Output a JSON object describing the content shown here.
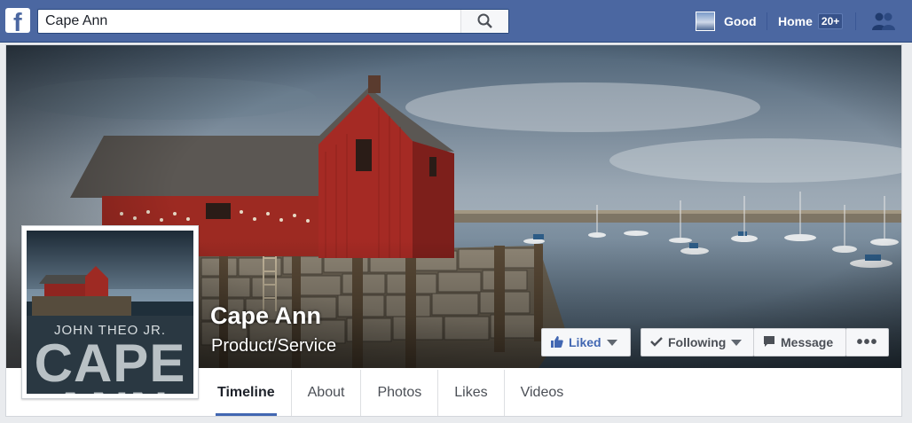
{
  "topbar": {
    "logo_letter": "f",
    "search_value": "Cape Ann",
    "user_name": "Good",
    "home_label": "Home",
    "home_badge": "20+"
  },
  "page": {
    "title": "Cape Ann",
    "category": "Product/Service"
  },
  "profile_picture": {
    "author": "JOHN THEO JR.",
    "book_title": "CAPE",
    "book_title_second_line": "ANN"
  },
  "actions": {
    "liked": "Liked",
    "following": "Following",
    "message": "Message",
    "more": "•••"
  },
  "tabs": [
    {
      "label": "Timeline",
      "active": true
    },
    {
      "label": "About",
      "active": false
    },
    {
      "label": "Photos",
      "active": false
    },
    {
      "label": "Likes",
      "active": false
    },
    {
      "label": "Videos",
      "active": false
    }
  ],
  "colors": {
    "brand_blue": "#4b67a1",
    "link_blue": "#4267b2",
    "barn_red": "#a52a24"
  }
}
